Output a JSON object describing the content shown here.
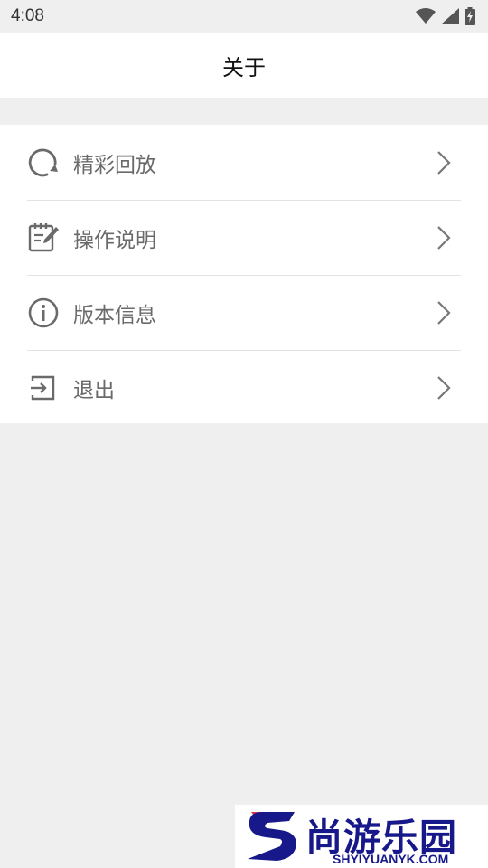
{
  "status_bar": {
    "time": "4:08",
    "icons": [
      "wifi-icon",
      "signal-icon",
      "battery-charging-icon"
    ]
  },
  "header": {
    "title": "关于"
  },
  "menu": {
    "items": [
      {
        "label": "精彩回放",
        "icon": "replay-icon"
      },
      {
        "label": "操作说明",
        "icon": "edit-note-icon"
      },
      {
        "label": "版本信息",
        "icon": "info-icon"
      },
      {
        "label": "退出",
        "icon": "exit-icon"
      }
    ]
  },
  "watermark": {
    "brand_cn": "尚游乐园",
    "brand_en": "SHYIYUANYK.COM",
    "accent_color": "#17198a",
    "logo_accent": "#e0303a"
  },
  "colors": {
    "background": "#efefef",
    "surface": "#ffffff",
    "label": "#6a6a6a",
    "divider": "#e2e2e2"
  }
}
